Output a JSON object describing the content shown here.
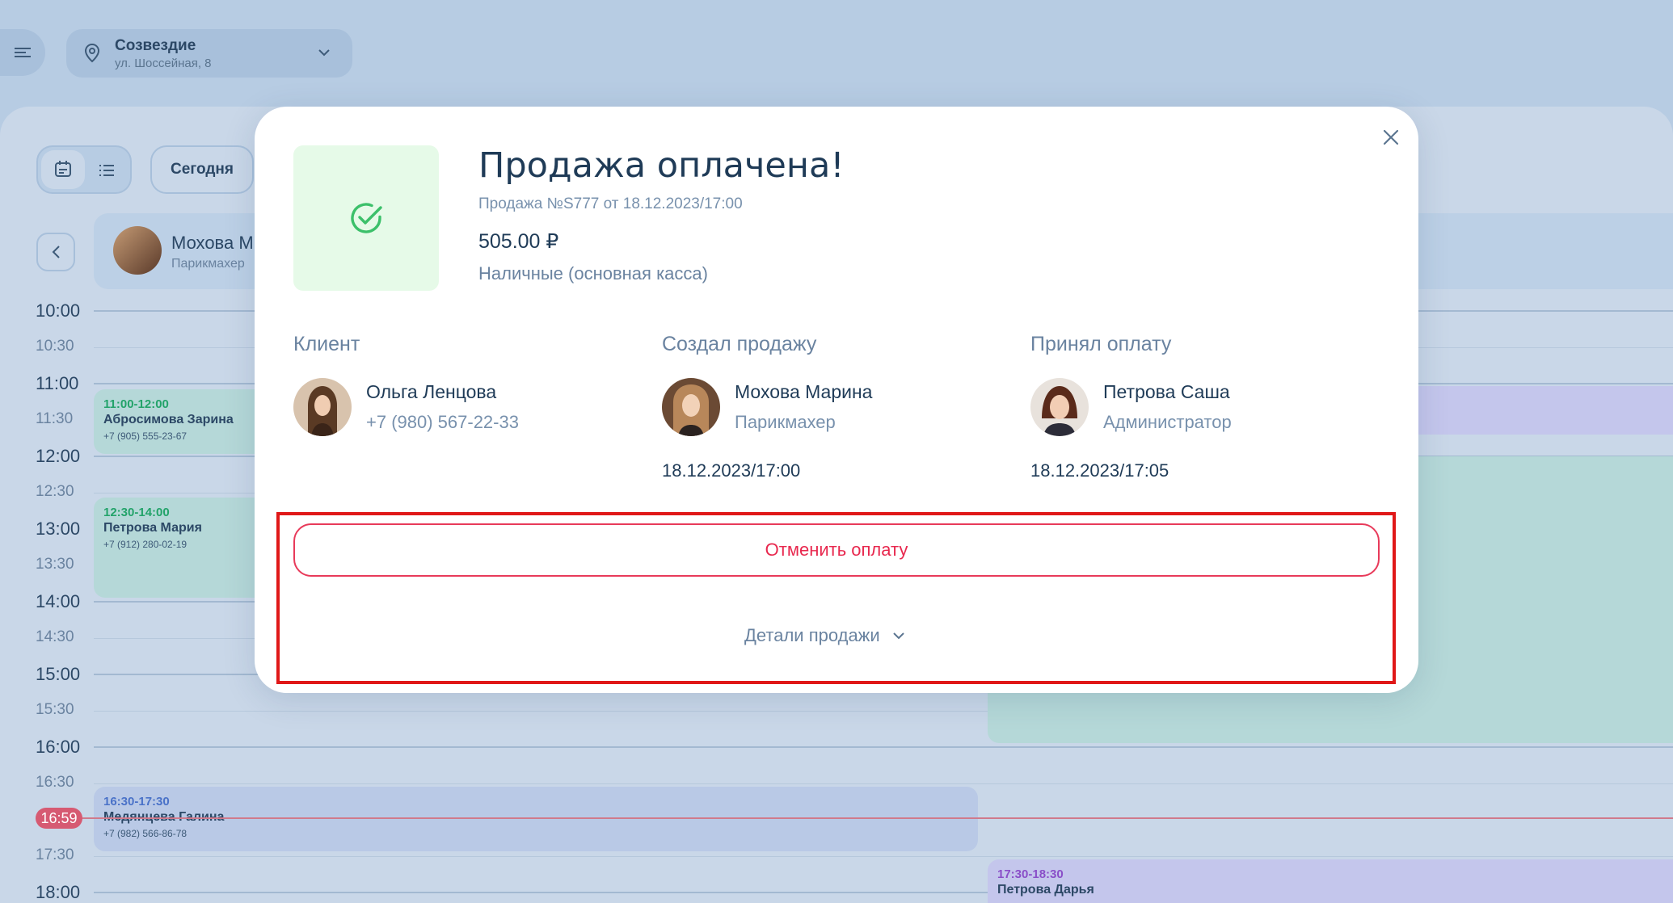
{
  "location": {
    "name": "Созвездие",
    "address": "ул. Шоссейная, 8"
  },
  "toolbar": {
    "today_label": "Сегодня"
  },
  "staff": {
    "name": "Мохова М",
    "role": "Парикмахер"
  },
  "time_slots": [
    {
      "label": "10:00",
      "half": false
    },
    {
      "label": "10:30",
      "half": true
    },
    {
      "label": "11:00",
      "half": false
    },
    {
      "label": "11:30",
      "half": true
    },
    {
      "label": "12:00",
      "half": false
    },
    {
      "label": "12:30",
      "half": true
    },
    {
      "label": "13:00",
      "half": false
    },
    {
      "label": "13:30",
      "half": true
    },
    {
      "label": "14:00",
      "half": false
    },
    {
      "label": "14:30",
      "half": true
    },
    {
      "label": "15:00",
      "half": false
    },
    {
      "label": "15:30",
      "half": true
    },
    {
      "label": "16:00",
      "half": false
    },
    {
      "label": "16:30",
      "half": true
    },
    {
      "label": "17:30",
      "half": true
    },
    {
      "label": "18:00",
      "half": false
    }
  ],
  "current_time": "16:59",
  "appointments": [
    {
      "time": "11:00-12:00",
      "name": "Абросимова Зарина",
      "phone": "+7 (905) 555-23-67"
    },
    {
      "time": "12:30-14:00",
      "name": "Петрова Мария",
      "phone": "+7 (912) 280-02-19"
    },
    {
      "time": "16:30-17:30",
      "name": "Медянцева Галина",
      "phone": "+7 (982) 566-86-78"
    },
    {
      "time": "17:30-18:30",
      "name": "Петрова Дарья",
      "phone": ""
    }
  ],
  "modal": {
    "title": "Продажа оплачена!",
    "subtitle": "Продажа №S777 от 18.12.2023/17:00",
    "amount": "505.00 ₽",
    "payment_method": "Наличные (основная касса)",
    "client": {
      "heading": "Клиент",
      "name": "Ольга Ленцова",
      "phone": "+7 (980) 567-22-33"
    },
    "creator": {
      "heading": "Создал продажу",
      "name": "Мохова Марина",
      "role": "Парикмахер",
      "date": "18.12.2023/17:00"
    },
    "receiver": {
      "heading": "Принял оплату",
      "name": "Петрова Саша",
      "role": "Администратор",
      "date": "18.12.2023/17:05"
    },
    "cancel_label": "Отменить оплату",
    "details_label": "Детали продажи"
  },
  "colors": {
    "accent_danger": "#e8284e",
    "success": "#3cc06a",
    "highlight": "#e01818"
  }
}
